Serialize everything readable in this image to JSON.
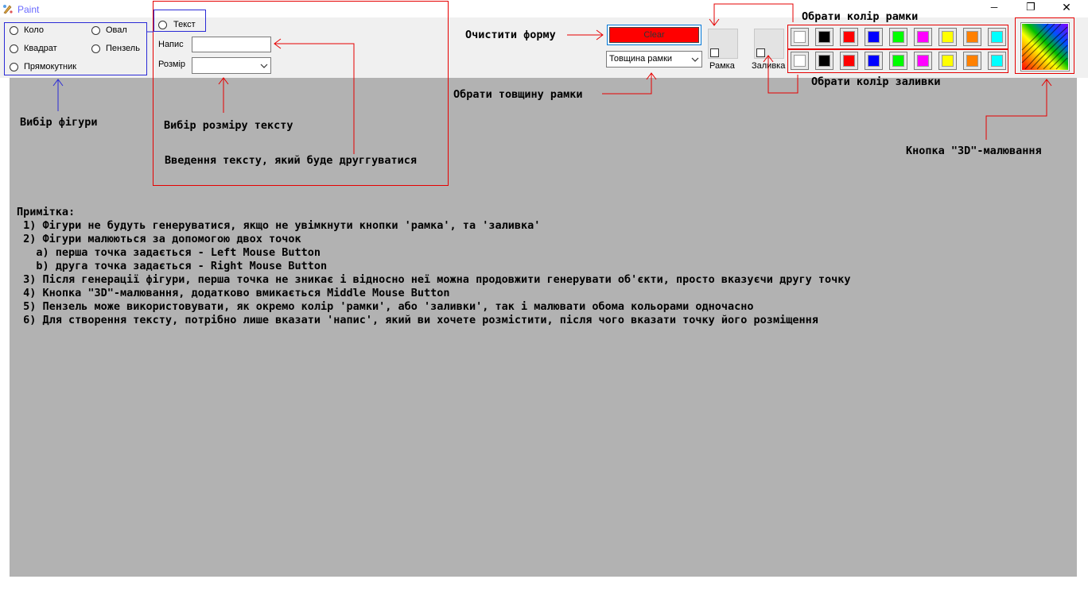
{
  "window": {
    "title": "Paint"
  },
  "shapes": {
    "circle": "Коло",
    "oval": "Овал",
    "square": "Квадрат",
    "brush": "Пензель",
    "rectangle": "Прямокутник",
    "text": "Текст"
  },
  "text_tools": {
    "inscription_label": "Напис",
    "inscription_value": "",
    "size_label": "Розмір",
    "size_value": ""
  },
  "clear_button": {
    "label": "Clear",
    "color": "#ff0000"
  },
  "border_width": {
    "placeholder": "Товщина рамки"
  },
  "frame_toggle": {
    "label": "Рамка",
    "checked": false
  },
  "fill_toggle": {
    "label": "Заливка",
    "checked": false
  },
  "palette": {
    "colors": [
      "#ffffff",
      "#000000",
      "#ff0000",
      "#0000ff",
      "#00ff00",
      "#ff00ff",
      "#ffff00",
      "#ff8000",
      "#00ffff"
    ]
  },
  "annotations": {
    "shape_choice": "Вибір фігури",
    "text_size_choice": "Вибір розміру тексту",
    "text_input": "Введення тексту, який буде друггуватися",
    "clear_form": "Очистити форму",
    "border_width_choice": "Обрати товщину рамки",
    "border_color_choice": "Обрати колір рамки",
    "fill_color_choice": "Обрати колір заливки",
    "button_3d": "Кнопка \"3D\"-малювання"
  },
  "notes": {
    "title": "Примітка:",
    "lines": [
      " 1) Фігури не будуть генеруватися, якщо не увімкнути кнопки 'рамка', та 'заливка'",
      " 2) Фігури малюються за допомогою двох точок",
      "   a) перша точка задається - Left Mouse Button",
      "   b) друга точка задається - Right Mouse Button",
      " 3) Після генерації фігури, перша точка не зникає і відносно неї можна продовжити генерувати об'єкти, просто вказуєчи другу точку",
      " 4) Кнопка \"3D\"-малювання, додатково вмикається Middle Mouse Button",
      " 5) Пензель може використовувати, як окремо колір 'рамки', або 'заливки', так і малювати обома кольорами одночасно",
      " 6) Для створення тексту, потрібно лише вказати 'напис', який ви хочете розмістити, після чого вказати точку його розміщення"
    ]
  },
  "window_controls": {
    "minimize": "─",
    "restore": "❐",
    "close": "✕"
  }
}
